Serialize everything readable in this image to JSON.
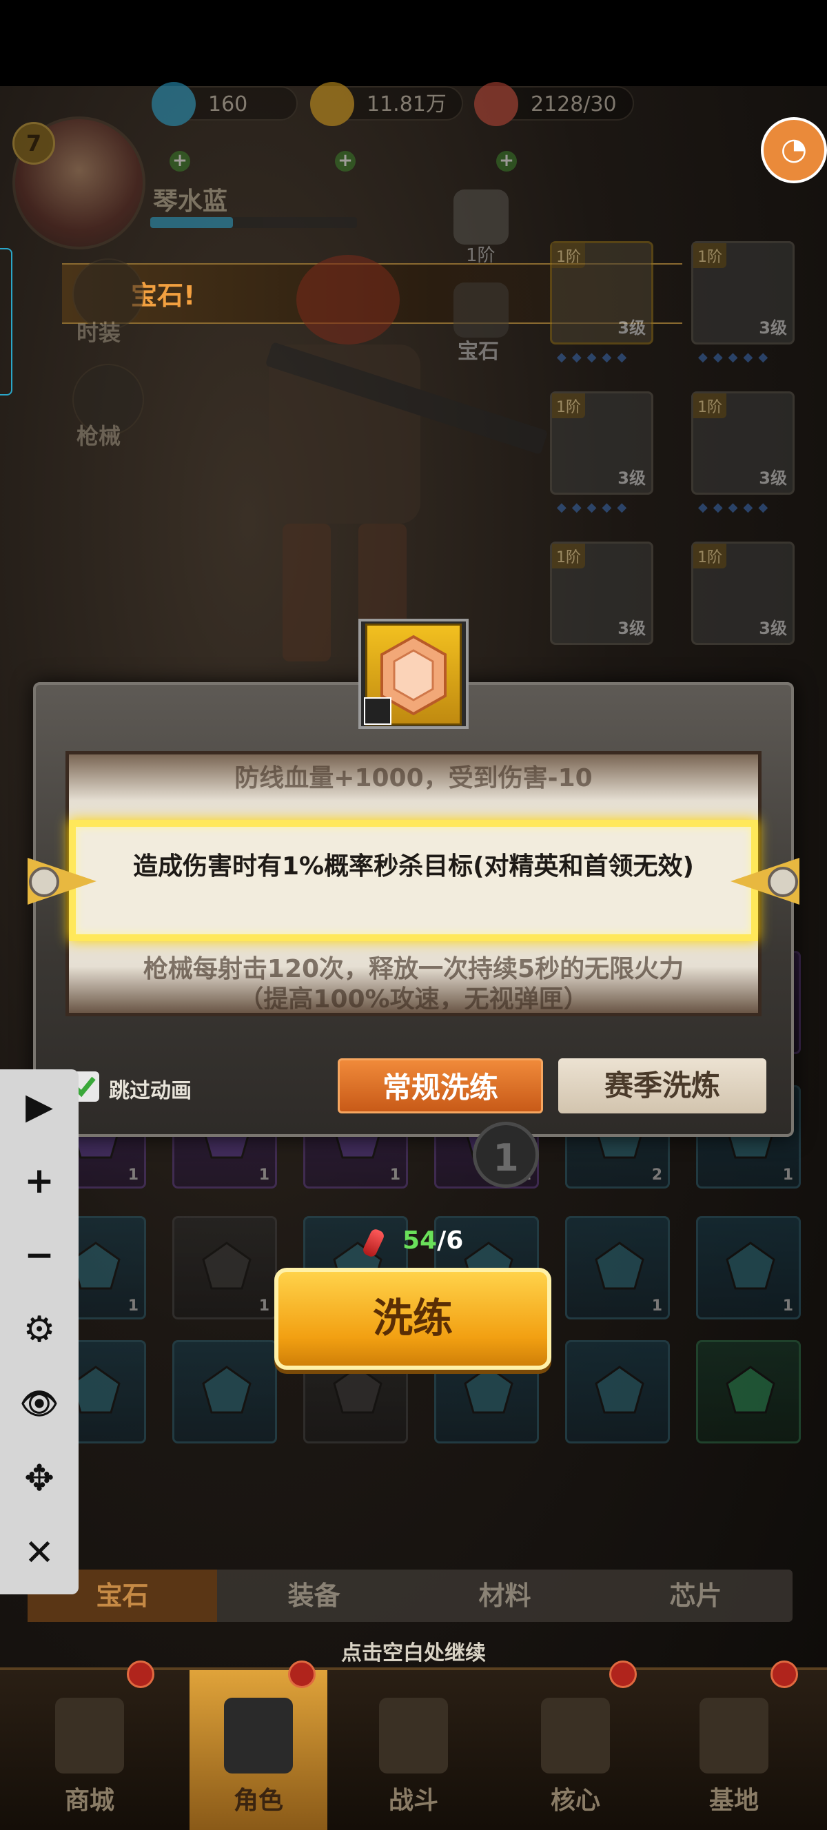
{
  "header": {
    "level": "7",
    "player_name": "琴水蓝",
    "resources": [
      {
        "icon": "diamond-icon",
        "value": "160"
      },
      {
        "icon": "gold-coin-icon",
        "value": "11.81万"
      },
      {
        "icon": "meat-icon",
        "value": "2128/30"
      }
    ]
  },
  "banner": {
    "text": "宝石!"
  },
  "side_menu": [
    {
      "icon": "outfit-icon",
      "label": "时装"
    },
    {
      "icon": "pistol-icon",
      "label": "枪械"
    }
  ],
  "center_slots": [
    {
      "icon": "shield-badge-icon",
      "label": "1阶"
    },
    {
      "icon": "gem-slot-icon",
      "label": "宝石"
    }
  ],
  "equipment": [
    {
      "tier": "1阶",
      "level": "3级",
      "icon": "helmet-icon"
    },
    {
      "tier": "1阶",
      "level": "3级",
      "icon": "gloves-icon"
    },
    {
      "tier": "1阶",
      "level": "3级",
      "icon": "vest-icon"
    },
    {
      "tier": "1阶",
      "level": "3级",
      "icon": "pants-icon"
    },
    {
      "tier": "1阶",
      "level": "3级",
      "icon": "boots-icon"
    },
    {
      "tier": "1阶",
      "level": "3级",
      "icon": "gauntlet-icon"
    }
  ],
  "modal": {
    "attr_prev": "防线血量+1000，受到伤害-10",
    "attr_current": "造成伤害时有1%概率秒杀目标(对精英和首领无效)",
    "attr_next": "枪械每射击120次，释放一次持续5秒的无限火力（提高100%攻速，无视弹匣）",
    "skip_label": "跳过动画",
    "skip_checked": true,
    "tab_regular": "常规洗练",
    "tab_season": "赛季洗炼",
    "timer_value": "1",
    "cost_have": "54",
    "cost_need": "/6",
    "refine_label": "洗练"
  },
  "inventory_rows": [
    [
      {
        "c": "purple",
        "n": "1"
      },
      {
        "c": "purple",
        "n": "1"
      },
      {
        "c": "purple",
        "n": "1"
      },
      {
        "c": "purple",
        "n": "1"
      },
      {
        "c": "purple",
        "n": "1"
      },
      {
        "c": "purple",
        "n": "1"
      }
    ],
    [
      {
        "c": "purple",
        "n": "1"
      },
      {
        "c": "purple",
        "n": "1"
      },
      {
        "c": "purple",
        "n": "1"
      },
      {
        "c": "purple",
        "n": "1"
      },
      {
        "c": "blue",
        "n": "2"
      },
      {
        "c": "blue",
        "n": "1"
      }
    ],
    [
      {
        "c": "blue",
        "n": "1"
      },
      {
        "c": "gray",
        "n": "1"
      },
      {
        "c": "blue",
        "n": "1"
      },
      {
        "c": "blue",
        "n": "1"
      },
      {
        "c": "blue",
        "n": "1"
      },
      {
        "c": "blue",
        "n": "1"
      }
    ],
    [
      {
        "c": "blue",
        "n": ""
      },
      {
        "c": "blue",
        "n": ""
      },
      {
        "c": "gray",
        "n": ""
      },
      {
        "c": "blue",
        "n": ""
      },
      {
        "c": "blue",
        "n": ""
      },
      {
        "c": "green",
        "n": ""
      }
    ]
  ],
  "bottom_tabs": [
    {
      "label": "宝石",
      "active": true
    },
    {
      "label": "装备",
      "active": false
    },
    {
      "label": "材料",
      "active": false
    },
    {
      "label": "芯片",
      "active": false
    }
  ],
  "continue_hint": "点击空白处继续",
  "nav": [
    {
      "label": "商城",
      "icon": "shop-icon",
      "active": false,
      "dot": true
    },
    {
      "label": "角色",
      "icon": "character-icon",
      "active": true,
      "dot": true
    },
    {
      "label": "战斗",
      "icon": "battle-icon",
      "active": false,
      "dot": false
    },
    {
      "label": "核心",
      "icon": "core-icon",
      "active": false,
      "dot": true
    },
    {
      "label": "基地",
      "icon": "base-icon",
      "active": false,
      "dot": true
    }
  ],
  "toolbar": [
    {
      "icon": "play-icon",
      "glyph": "▶"
    },
    {
      "icon": "zoom-in-icon",
      "glyph": "+"
    },
    {
      "icon": "zoom-out-icon",
      "glyph": "−"
    },
    {
      "icon": "settings-gear-icon",
      "glyph": "⚙"
    },
    {
      "icon": "hide-eye-icon",
      "glyph": "👁"
    },
    {
      "icon": "move-icon",
      "glyph": "✥"
    },
    {
      "icon": "close-icon",
      "glyph": "✕"
    }
  ],
  "colors": {
    "accent_orange": "#e8803a",
    "highlight_yellow": "#ffe85a",
    "refine_gold": "#f2a012",
    "cost_green": "#6ae05a"
  }
}
